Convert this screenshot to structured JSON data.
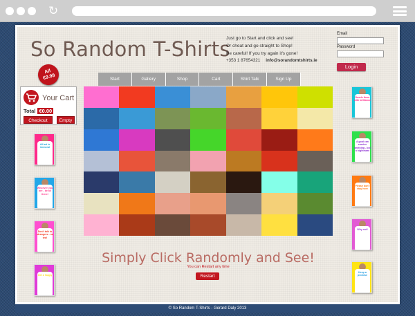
{
  "site": {
    "title": "So Random T-Shirts",
    "badge_line1": "All",
    "badge_line2": "€9.99",
    "tagline_1": "Just go to Start and click and see!",
    "tagline_2": "Or cheat and go straight to Shop!",
    "tagline_3": "Be careful! If you try again it's gone!",
    "phone": "+353 1 87654321",
    "email": "info@sorandomtshirts.ie"
  },
  "login": {
    "email_label": "Email",
    "password_label": "Password",
    "button": "Login"
  },
  "nav": [
    "Start",
    "Gallery",
    "Shop",
    "Cart",
    "Shirt Talk",
    "Sign Up"
  ],
  "cart": {
    "title": "Your Cart",
    "total_label": "Total",
    "total_value": "€0.00",
    "checkout": "Checkout",
    "empty": "Empty"
  },
  "left_tees": [
    {
      "text": "All art is immoral",
      "bg": "#ff2a8a",
      "fg": "#22a3d8"
    },
    {
      "text": "Whoever you are - be all there!",
      "bg": "#22a7e8",
      "fg": "#ff3d8f"
    },
    {
      "text": "Don't talk to strangers - no tea!",
      "bg": "#ff4fd0",
      "fg": "#f23a20"
    },
    {
      "text": "Get a happy",
      "bg": "#e03ad8",
      "fg": "#ffe02a"
    }
  ],
  "right_tees": [
    {
      "text": "Dazzle them with brilliance",
      "bg": "#19c6d8",
      "fg": "#ff2a8a"
    },
    {
      "text": "A goal can survive anything - but a nightmare",
      "bg": "#2ee04c",
      "fg": "#8b2fd1"
    },
    {
      "text": "Please don't stay here",
      "bg": "#ff7a12",
      "fg": "#ff7a12"
    },
    {
      "text": "Why not!",
      "bg": "#e25ad4",
      "fg": "#9a3bd4"
    },
    {
      "text": "Keep a promise",
      "bg": "#ffe414",
      "fg": "#1e9be0"
    }
  ],
  "mosaic": [
    "#ff6ed0",
    "#f23a20",
    "#3a8fd6",
    "#8aa8c8",
    "#e8a040",
    "#ffc60a",
    "#cfe000",
    "#2b6aa8",
    "#3a9ad6",
    "#7d9455",
    "#6ab830",
    "#b8684a",
    "#ffd23a",
    "#f4e8a8",
    "#2f78d4",
    "#d83ac0",
    "#4f4f4f",
    "#45d62a",
    "#e04a3a",
    "#9a1c14",
    "#ff7a1a",
    "#b4c0d6",
    "#e8543a",
    "#8a7a6a",
    "#f2a2b0",
    "#bc7a22",
    "#d8321c",
    "#6a6058",
    "#2a3a6a",
    "#3a7aa8",
    "#d4d0c4",
    "#8a6430",
    "#2a1810",
    "#84ffe8",
    "#18a47a",
    "#e8e2c0",
    "#f07818",
    "#e8a08a",
    "#e89870",
    "#8a8482",
    "#f4d078",
    "#5a8a30",
    "#ffb2d2",
    "#aa3a18",
    "#6a4a3a",
    "#a84a2a",
    "#c8b8a8",
    "#ffe040",
    "#2a4a80"
  ],
  "main": {
    "headline": "Simply Click Randomly and See!",
    "subline": "You can Restart any time",
    "restart": "Restart"
  },
  "footer": "© So Random T-Shirts - Gerard Daly 2013"
}
